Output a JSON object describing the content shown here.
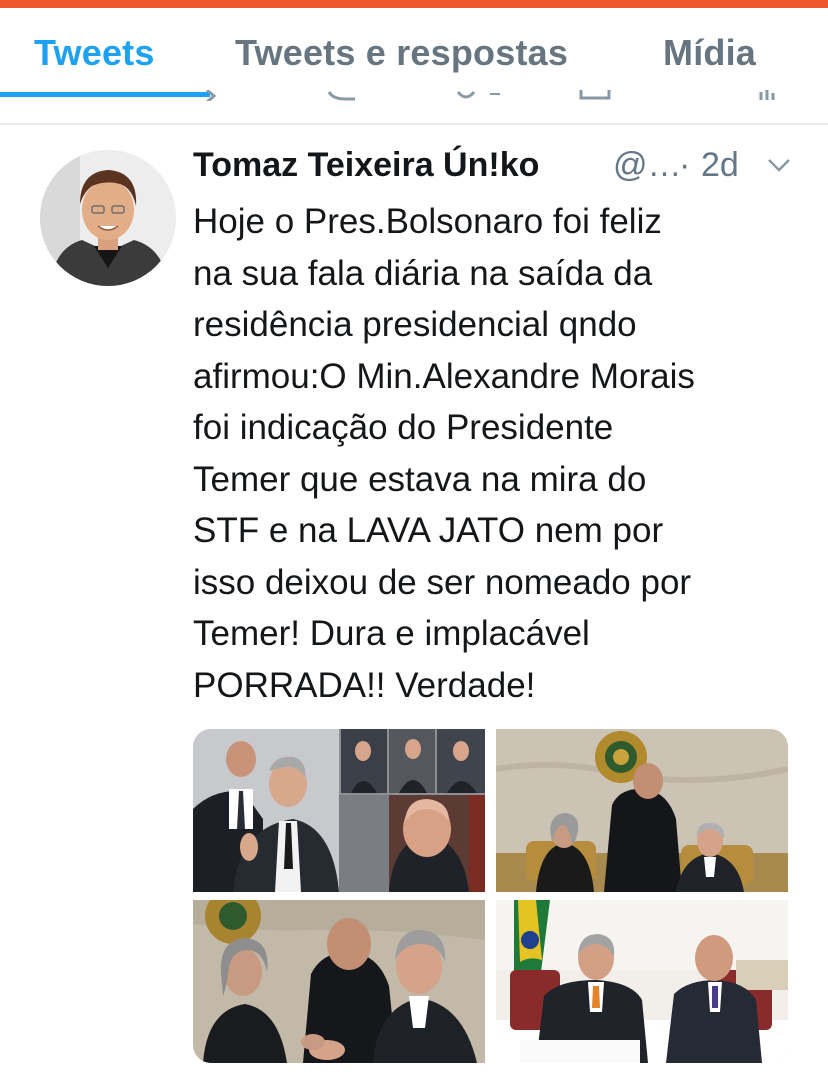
{
  "tabs": [
    {
      "label": "Tweets",
      "active": true
    },
    {
      "label": "Tweets e respostas",
      "active": false
    },
    {
      "label": "Mídia",
      "active": false
    }
  ],
  "colors": {
    "accent": "#1da1f2",
    "top_bar": "#f2552c",
    "secondary_text": "#657786",
    "tab_inactive": "#66757f"
  },
  "tweet": {
    "author_name": "Tomaz Teixeira Ún!ko",
    "handle": "@…",
    "separator": "·",
    "time": "2d",
    "menu_icon": "chevron-down-icon",
    "text_lines": [
      "Hoje o Pres.Bolsonaro foi feliz",
      "na sua fala diária na saída da",
      "residência presidencial qndo",
      "afirmou:O Min.Alexandre Morais",
      "foi indicação do Presidente",
      "Temer que estava na mira do",
      "STF e na LAVA JATO nem por",
      "isso deixou de ser nomeado por",
      "Temer! Dura e implacável",
      "PORRADA!! Verdade!"
    ],
    "media_count": 4
  }
}
